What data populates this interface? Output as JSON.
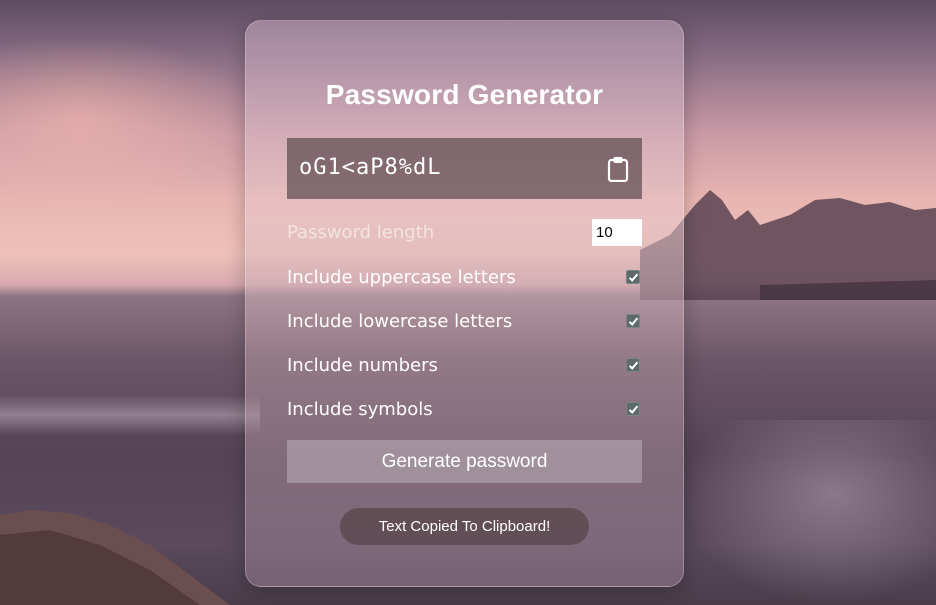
{
  "app": {
    "title": "Password Generator"
  },
  "password": {
    "value": "oG1<aP8%dL"
  },
  "options": {
    "length_label": "Password length",
    "length_value": "10",
    "items": [
      {
        "label": "Include uppercase letters",
        "checked": true
      },
      {
        "label": "Include lowercase letters",
        "checked": true
      },
      {
        "label": "Include numbers",
        "checked": true
      },
      {
        "label": "Include symbols",
        "checked": true
      }
    ]
  },
  "actions": {
    "generate_label": "Generate password"
  },
  "toast": {
    "message": "Text Copied To Clipboard!"
  },
  "icons": {
    "copy": "clipboard-icon",
    "check": "checkmark-icon"
  },
  "colors": {
    "text": "#ffffff",
    "password_box": "#645055",
    "checkbox": "#5e6a6a"
  }
}
